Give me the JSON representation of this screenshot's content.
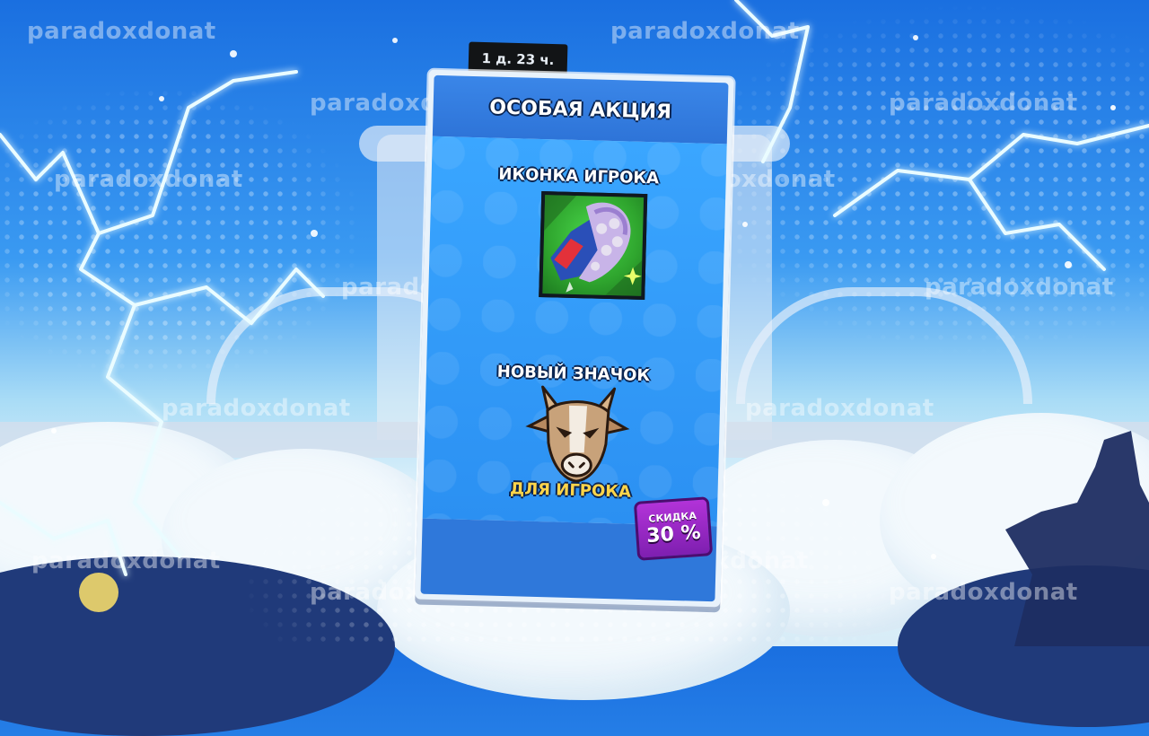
{
  "offer": {
    "timer": "1 д. 23 ч.",
    "title": "ОСОБАЯ АКЦИЯ",
    "items": [
      {
        "label": "ИКОНКА ИГРОКА",
        "icon": "boot-kick-player-icon"
      },
      {
        "label": "НОВЫЙ ЗНАЧОК",
        "icon": "goat-pin-icon",
        "caption": "ДЛЯ ИГРОКА"
      }
    ],
    "discount": {
      "label": "СКИДКА",
      "value": "30 %"
    }
  },
  "watermark": "paradoxdonat",
  "colors": {
    "card_blue": "#2b90f2",
    "header_blue": "#3a86e8",
    "discount_purple": "#9a2ad0",
    "caption_yellow": "#ffd54a"
  }
}
